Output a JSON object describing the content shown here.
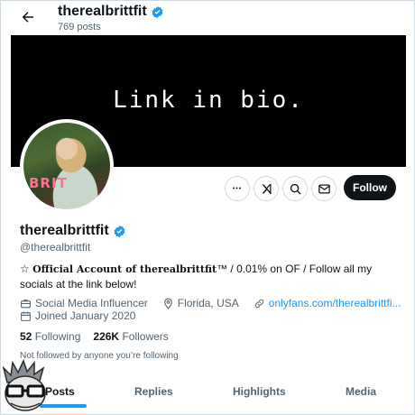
{
  "header": {
    "title": "therealbrittfit",
    "post_count": "769 posts"
  },
  "banner": {
    "text": "Link in bio."
  },
  "avatar": {
    "sign_text": "BRIT"
  },
  "actions": {
    "more_label": "•••",
    "follow_label": "Follow"
  },
  "profile": {
    "display_name": "therealbrittfit",
    "handle": "@therealbrittfit",
    "bio_prefix": "☆ ",
    "bio_bold": "Official Account of therealbrittfit",
    "bio_rest": "™ / 0.01% on OF / Follow all my socials at the link below!",
    "category": "Social Media Influencer",
    "location": "Florida, USA",
    "link": "onlyfans.com/therealbrittfi...",
    "joined": "Joined January 2020"
  },
  "stats": {
    "following_count": "52",
    "following_label": "Following",
    "followers_count": "226K",
    "followers_label": "Followers"
  },
  "not_followed_text": "Not followed by anyone you’re following",
  "tabs": [
    {
      "label": "Posts"
    },
    {
      "label": "Replies"
    },
    {
      "label": "Highlights"
    },
    {
      "label": "Media"
    }
  ],
  "colors": {
    "accent": "#1d9bf0",
    "text": "#0f1419",
    "muted": "#536471"
  }
}
